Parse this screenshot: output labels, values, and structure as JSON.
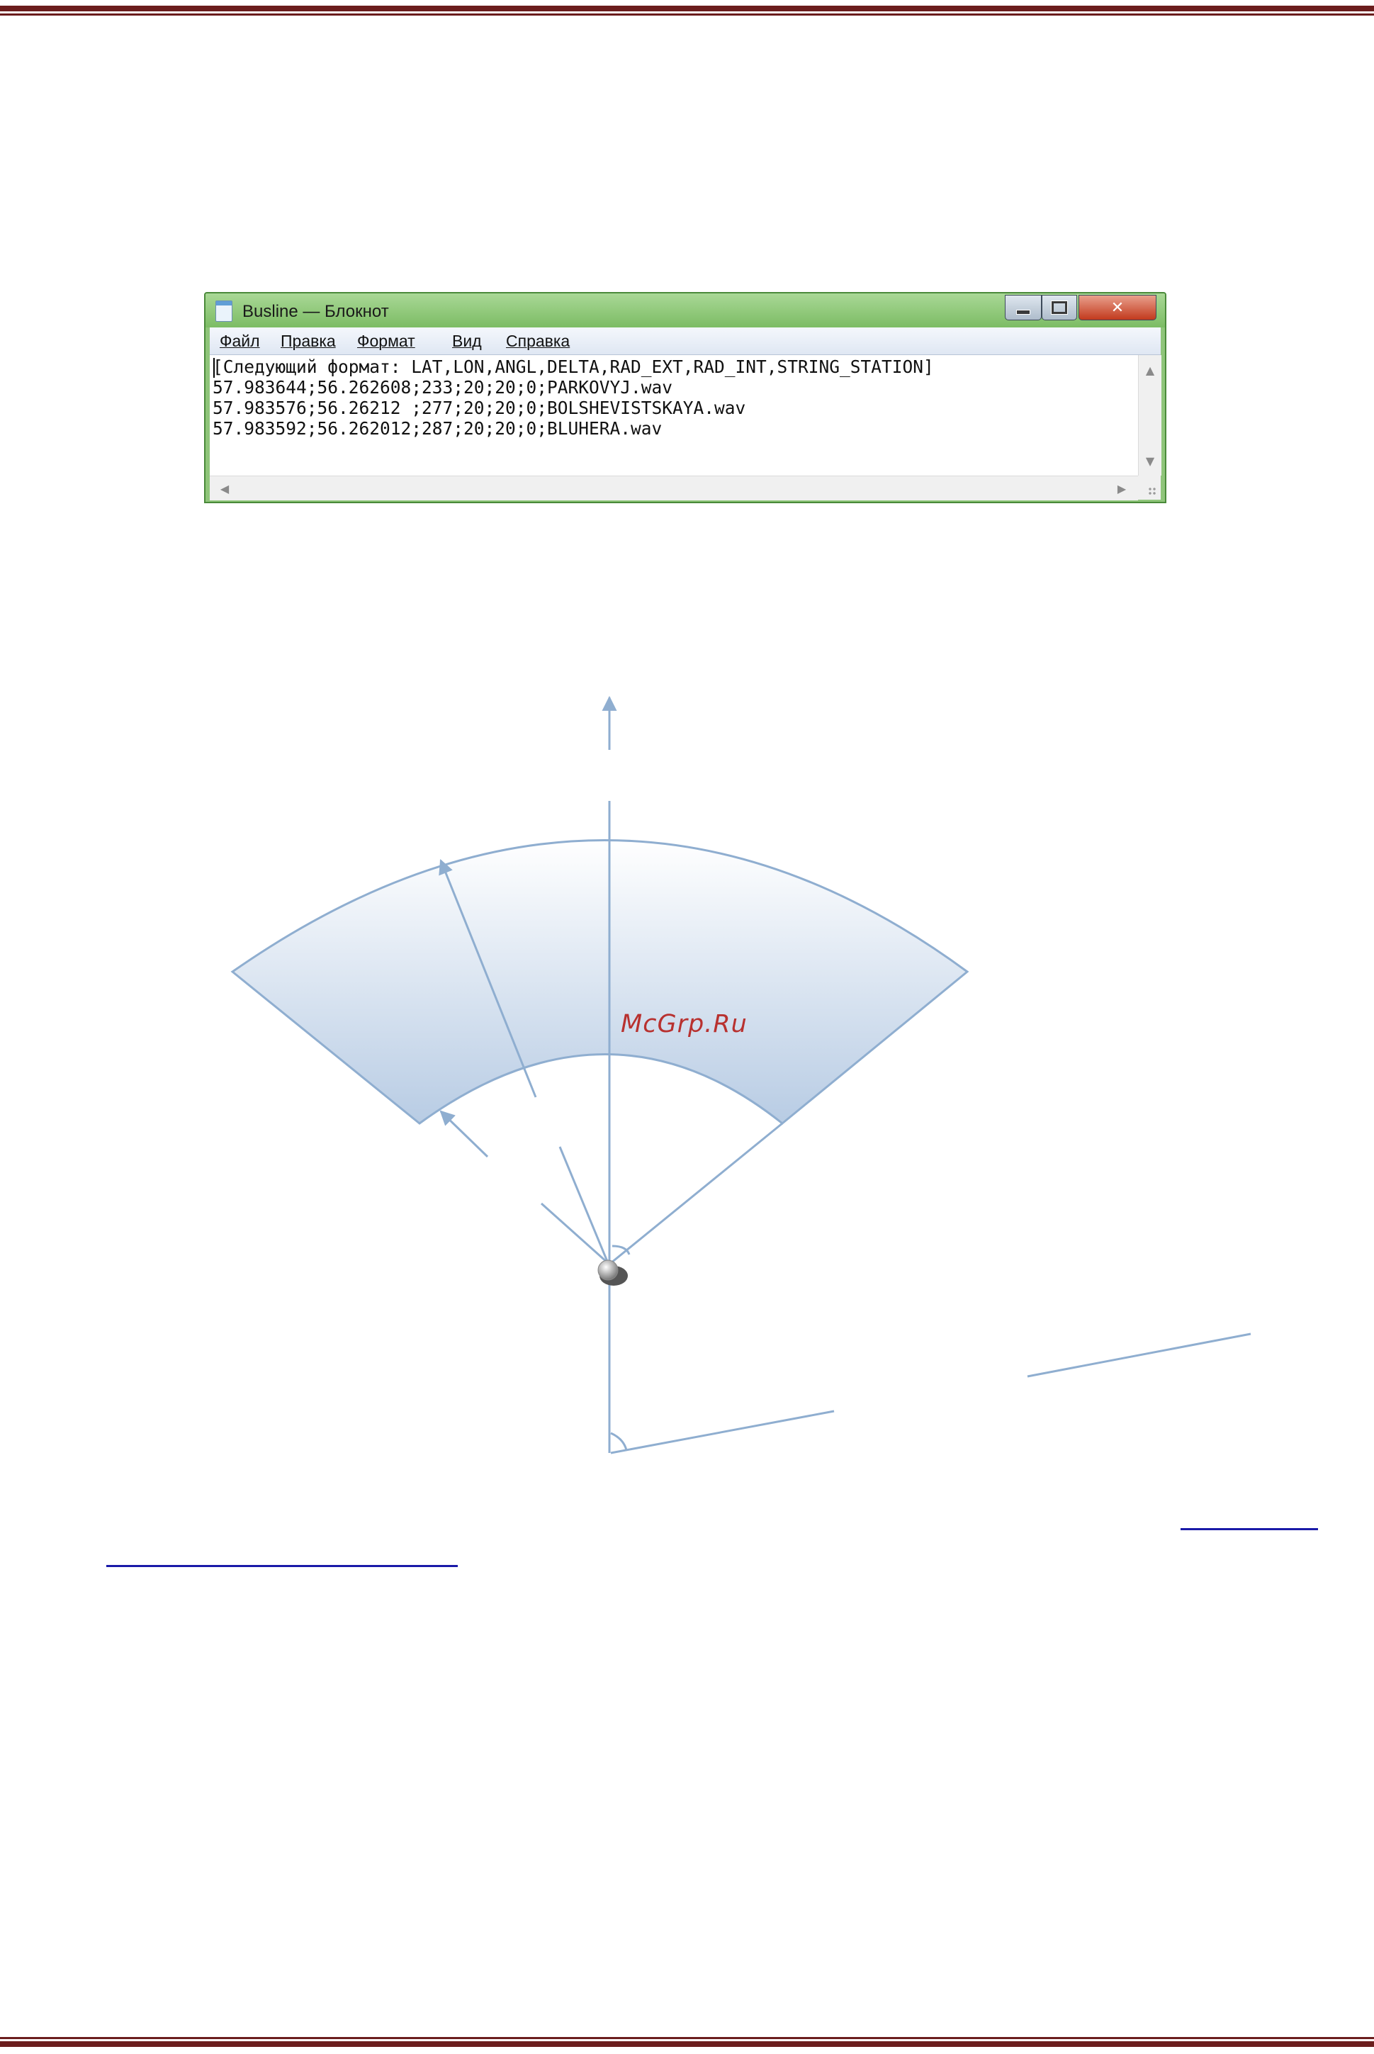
{
  "window": {
    "title": "Busline — Блокнот"
  },
  "menu": {
    "file": "Файл",
    "edit": "Правка",
    "format": "Формат",
    "view": "Вид",
    "help": "Справка"
  },
  "text_lines": [
    "[Следующий формат: LAT,LON,ANGL,DELTA,RAD_EXT,RAD_INT,STRING_STATION]",
    "57.983644;56.262608;233;20;20;0;PARKOVYJ.wav",
    "57.983576;56.26212 ;277;20;20;0;BOLSHEVISTSKAYA.wav",
    "57.983592;56.262012;287;20;20;0;BLUHERA.wav"
  ],
  "watermark": "McGrp.Ru",
  "colors": {
    "border_rule": "#6b1d1d",
    "titlebar": "#8fc57a",
    "diagram_line": "#8faed0",
    "sector_fill_top": "#ffffff",
    "sector_fill_bottom": "#b8cce4",
    "watermark": "#b8312f",
    "link": "#1a1aa8"
  }
}
